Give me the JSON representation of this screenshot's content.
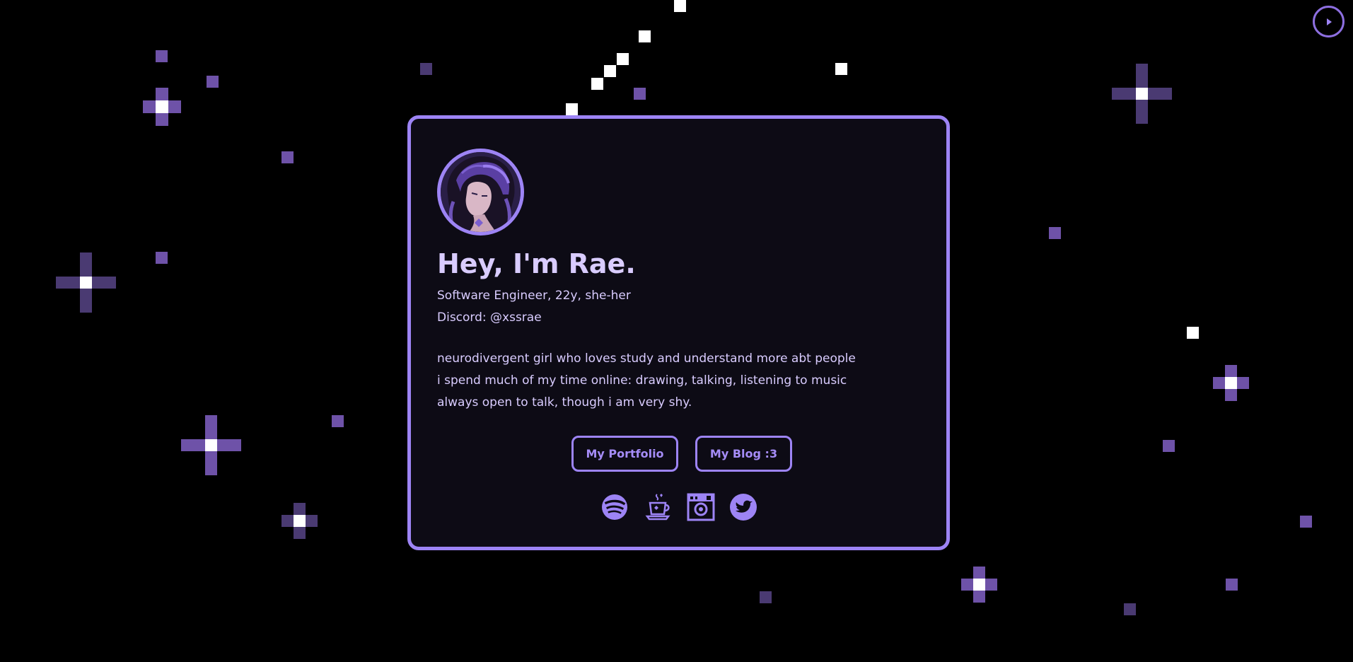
{
  "profile": {
    "name_line": "Hey, I'm Rae.",
    "subtitle": "Software Engineer, 22y, she-her",
    "discord": "Discord: @xssrae",
    "bio": [
      "neurodivergent girl who loves study and understand more abt people",
      "i spend much of my time online: drawing, talking, listening to music",
      "always open to talk, though i am very shy."
    ]
  },
  "buttons": {
    "portfolio": "My Portfolio",
    "blog": "My Blog :3"
  },
  "social_icons": [
    "spotify-icon",
    "ko-fi-cup-icon",
    "instagram-icon",
    "twitter-icon"
  ],
  "controls": {
    "play_icon": "play-icon"
  },
  "colors": {
    "background": "#000000",
    "card_background": "#0d0b15",
    "accent": "#9d84f5",
    "text": "#d9ccff",
    "star_white": "#ffffff",
    "star_purple": "#6e52a8",
    "star_dim": "#4a3a72"
  }
}
